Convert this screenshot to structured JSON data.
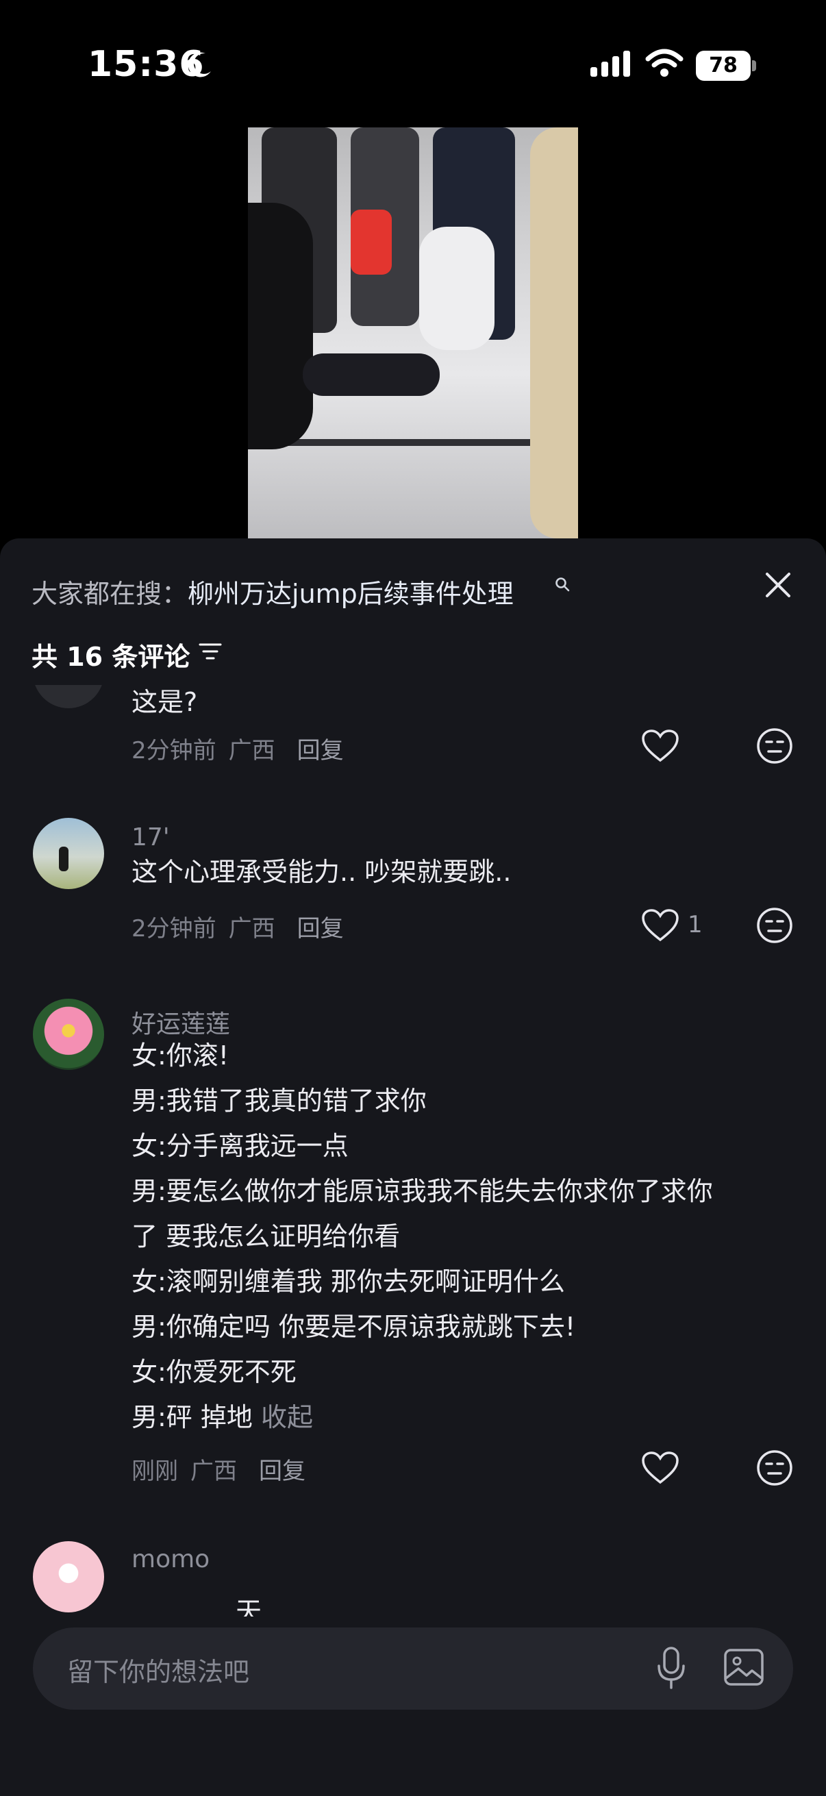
{
  "status_bar": {
    "time": "15:36",
    "battery": "78"
  },
  "search": {
    "prefix": "大家都在搜：",
    "term": "柳州万达jump后续事件处理"
  },
  "comment_count": "共 16 条评论",
  "comments": [
    {
      "text": "这是?",
      "time": "2分钟前",
      "location": "广西",
      "reply": "回复",
      "likes": ""
    },
    {
      "username": "17'",
      "text": "这个心理承受能力.. 吵架就要跳..",
      "time": "2分钟前",
      "location": "广西",
      "reply": "回复",
      "likes": "1"
    },
    {
      "username": "好运莲莲",
      "lines": [
        "女:你滚!",
        "男:我错了我真的错了求你",
        "女:分手离我远一点",
        "男:要怎么做你才能原谅我我不能失去你求你了求你",
        "了 要我怎么证明给你看",
        "女:滚啊别缠着我 那你去死啊证明什么",
        "男:你确定吗 你要是不原谅我就跳下去!",
        "女:你爱死不死"
      ],
      "last_line": "男:砰 掉地",
      "collapse": "收起",
      "time": "刚刚",
      "location": "广西",
      "reply": "回复",
      "likes": ""
    },
    {
      "username": "momo",
      "text": "天"
    }
  ],
  "input": {
    "placeholder": "留下你的想法吧"
  },
  "icons": [
    "moon-icon",
    "signal-icon",
    "wifi-icon",
    "battery-icon",
    "search-icon",
    "close-icon",
    "filter-icon",
    "heart-icon",
    "dislike-icon",
    "mic-icon",
    "image-icon"
  ]
}
